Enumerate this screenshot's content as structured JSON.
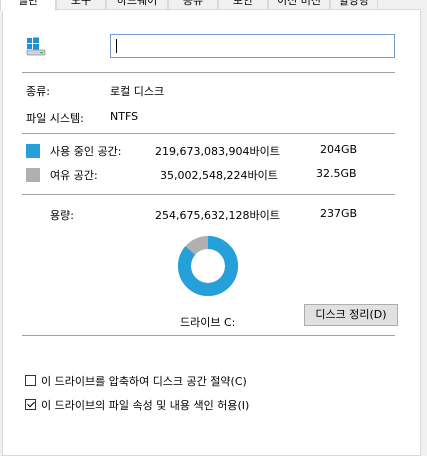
{
  "tabs": [
    "일반",
    "도구",
    "하드웨어",
    "공유",
    "보안",
    "이전 버전",
    "할당량"
  ],
  "drive_name_value": "",
  "type": {
    "label": "종류:",
    "value": "로컬 디스크"
  },
  "filesystem": {
    "label": "파일 시스템:",
    "value": "NTFS"
  },
  "used": {
    "label": "사용 중인 공간:",
    "bytes": "219,673,083,904바이트",
    "size": "204GB",
    "color": "#26a0da"
  },
  "free": {
    "label": "여유 공간:",
    "bytes": "35,002,548,224바이트",
    "size": "32.5GB",
    "color": "#b0b0b0"
  },
  "capacity": {
    "label": "용량:",
    "bytes": "254,675,632,128바이트",
    "size": "237GB"
  },
  "used_fraction": 0.8626,
  "drive_label": "드라이브 C:",
  "cleanup_button": "디스크 정리(D)",
  "compress": {
    "label": "이 드라이브를 압축하여 디스크 공간 절약(C)",
    "checked": false
  },
  "index": {
    "label": "이 드라이브의 파일 속성 및 내용 색인 허용(I)",
    "checked": true
  },
  "icons": {
    "drive": "windows-drive-icon"
  }
}
